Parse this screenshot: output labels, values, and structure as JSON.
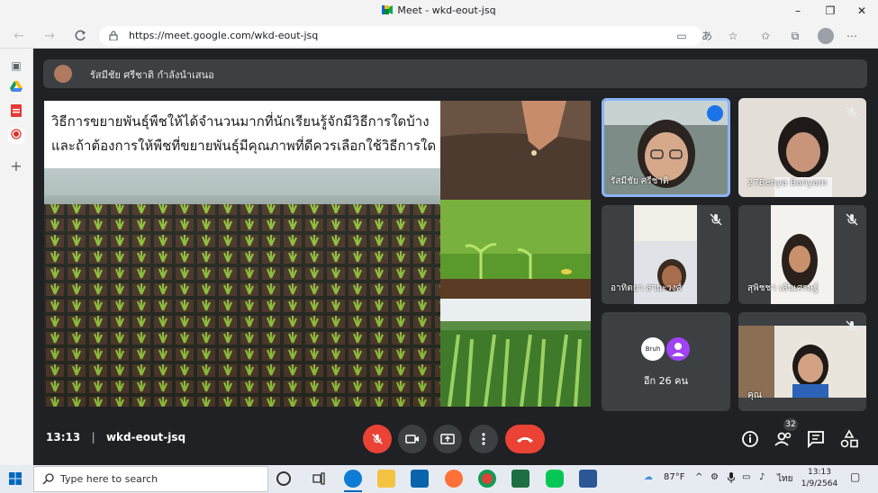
{
  "browser": {
    "window_title": "Meet - wkd-eout-jsq",
    "url": "https://meet.google.com/wkd-eout-jsq",
    "controls": {
      "minimize": "–",
      "maximize": "❐",
      "close": "✕"
    }
  },
  "meet": {
    "presenter_text": "รัสมีชัย ศรีชาติ กำลังนำเสนอ",
    "slide": {
      "line1": "วิธีการขยายพันธุ์พืชให้ได้จำนวนมากที่นักเรียนรู้จักมีวิธีการใดบ้าง",
      "line2": "และถ้าต้องการให้พืชที่ขยายพันธุ์มีคุณภาพที่ดีควรเลือกใช้วิธีการใด"
    },
    "participants": [
      {
        "name": "รัสมีชัย ศรีชาติ",
        "muted": false,
        "speaking": true
      },
      {
        "name": "27Benya Banyam",
        "muted": true
      },
      {
        "name": "อาทิตยา สายะวงศ์",
        "muted": true
      },
      {
        "name": "สุพิชชา เส้นเศรษฐ์",
        "muted": true
      },
      {
        "name": "อีก 26 คน",
        "avatar_label": "Bruh"
      },
      {
        "name": "คุณ",
        "muted": true
      }
    ],
    "meeting_time": "13:13",
    "meeting_code": "wkd-eout-jsq",
    "people_count": "32"
  },
  "taskbar": {
    "search_placeholder": "Type here to search",
    "weather": "87°F",
    "language": "ไทย",
    "time": "13:13",
    "date": "1/9/2564"
  },
  "colors": {
    "meet_bg": "#202124",
    "end_call": "#ea4335",
    "active_speaker": "#8ab4f8"
  }
}
